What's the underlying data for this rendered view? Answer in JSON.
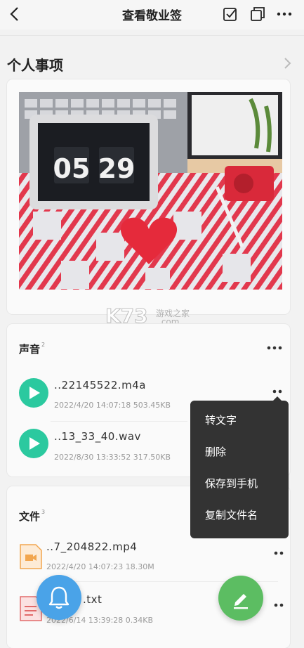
{
  "header": {
    "title": "查看敬业签"
  },
  "section": {
    "title": "个人事项"
  },
  "photo": {
    "clock_hours": "05",
    "clock_minutes": "29"
  },
  "audio": {
    "title": "声音",
    "count": "2",
    "items": [
      {
        "name": "..22145522.m4a",
        "meta": "2022/4/20 14:07:18 503.45KB"
      },
      {
        "name": "..13_33_40.wav",
        "meta": "2022/8/30 13:33:52 317.50KB"
      }
    ]
  },
  "files": {
    "title": "文件",
    "count": "3",
    "items": [
      {
        "name": "..7_204822.mp4",
        "meta": "2022/4/20 14:07:23 18.30M",
        "icon": "video-file-icon"
      },
      {
        "name": ".txt",
        "meta": "2022/6/14 13:39:28 0.34KB",
        "icon": "text-file-icon"
      }
    ]
  },
  "menu": {
    "items": [
      "转文字",
      "删除",
      "保存到手机",
      "复制文件名"
    ]
  },
  "watermark": {
    "brand": "K73",
    "site": "游戏之家",
    "domain": ".com"
  },
  "colors": {
    "play": "#2bc99f",
    "fab_bell": "#4aa3e8",
    "fab_edit": "#5cbd62",
    "menu_bg": "#333333"
  }
}
